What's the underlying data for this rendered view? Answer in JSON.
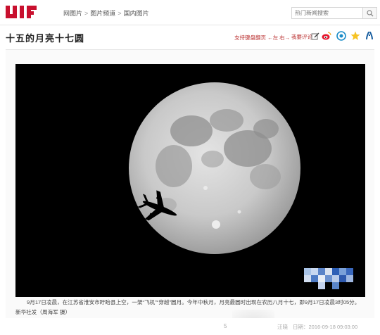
{
  "breadcrumb": {
    "items": [
      "网图片",
      "图片频道",
      "国内图片"
    ],
    "separator": ">"
  },
  "search": {
    "placeholder": "热门新闻搜索"
  },
  "article": {
    "title": "十五的月亮十七圆",
    "keyboard_hint": "支持键盘翻页 ←左 右→",
    "comment_label": "我要评论"
  },
  "share": {
    "icons": [
      "weibo-icon",
      "tencent-weibo-icon",
      "qzone-star-icon",
      "renren-icon"
    ]
  },
  "photo": {
    "subject": "full-moon-with-airplane-silhouette"
  },
  "caption": {
    "line1": "9月17日凌晨，在江苏省淮安市盱眙县上空，一架“飞机”“穿越”圆月。今年中秋月，月亮最圆时出现在农历八月十七，即9月17日凌晨3时05分。",
    "line2": "新华社发（周海军 摄）"
  },
  "footer": {
    "page_number": "5",
    "author": "汪晓",
    "date": "日期：2016-09-18 09:03:00"
  },
  "colors": {
    "brand_red": "#c8102e",
    "link_red": "#b33333",
    "photo_bg": "#000000"
  }
}
